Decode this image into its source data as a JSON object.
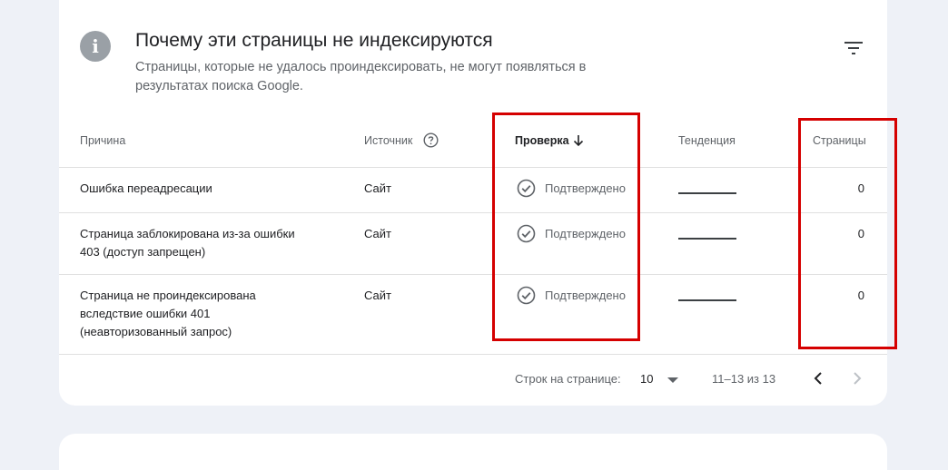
{
  "header": {
    "title": "Почему эти страницы не индексируются",
    "subtitle": "Страницы, которые не удалось проиндексировать, не могут появляться в результатах поиска Google."
  },
  "icons": {
    "info": "info-icon",
    "filter": "filter-icon",
    "help": "help-circle-icon",
    "sort": "arrow-down-icon",
    "check": "check-circle-icon"
  },
  "table": {
    "columns": {
      "reason": "Причина",
      "source": "Источник",
      "validation": "Проверка",
      "trend": "Тенденция",
      "pages": "Страницы"
    },
    "rows": [
      {
        "reason": "Ошибка переадресации",
        "source": "Сайт",
        "validation": "Подтверждено",
        "pages": "0"
      },
      {
        "reason": "Страница заблокирована из-за ошибки 403 (доступ запрещен)",
        "source": "Сайт",
        "validation": "Подтверждено",
        "pages": "0"
      },
      {
        "reason": "Страница не проиндексирована вследствие ошибки 401 (неавторизованный запрос)",
        "source": "Сайт",
        "validation": "Подтверждено",
        "pages": "0"
      }
    ]
  },
  "pagination": {
    "rows_per_page_label": "Строк на странице:",
    "rows_per_page_value": "10",
    "range": "11–13 из 13"
  },
  "colors": {
    "highlight": "#d50000",
    "background": "#eef1f7",
    "card": "#ffffff"
  }
}
